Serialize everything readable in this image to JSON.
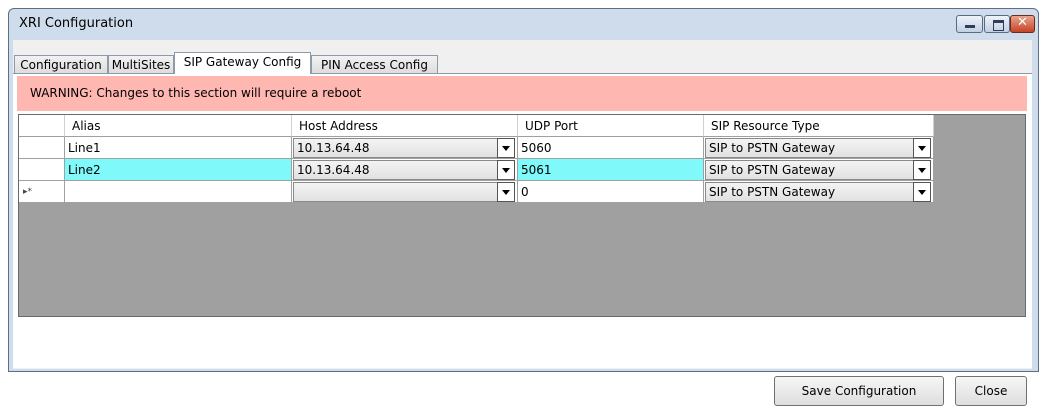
{
  "window": {
    "title": "XRI Configuration"
  },
  "tabs": [
    {
      "label": "Configuration"
    },
    {
      "label": "MultiSites"
    },
    {
      "label": "SIP Gateway Config",
      "active": true
    },
    {
      "label": "PIN Access Config"
    }
  ],
  "warning": {
    "text": "WARNING: Changes to this section will require a reboot",
    "color": "#ffb7b2"
  },
  "grid": {
    "columns": [
      "Alias",
      "Host Address",
      "UDP Port",
      "SIP Resource Type"
    ],
    "rows": [
      {
        "alias": "Line1",
        "host": "10.13.64.48",
        "port": "5060",
        "type": "SIP to PSTN Gateway",
        "selected": false
      },
      {
        "alias": "Line2",
        "host": "10.13.64.48",
        "port": "5061",
        "type": "SIP to PSTN Gateway",
        "selected": true
      },
      {
        "alias": "",
        "host": "",
        "port": "0",
        "type": "SIP to PSTN Gateway",
        "new_row_marker": "▸*"
      }
    ],
    "selection_color": "#7ff9f9"
  },
  "buttons": {
    "save": "Save Configuration",
    "close": "Close"
  }
}
